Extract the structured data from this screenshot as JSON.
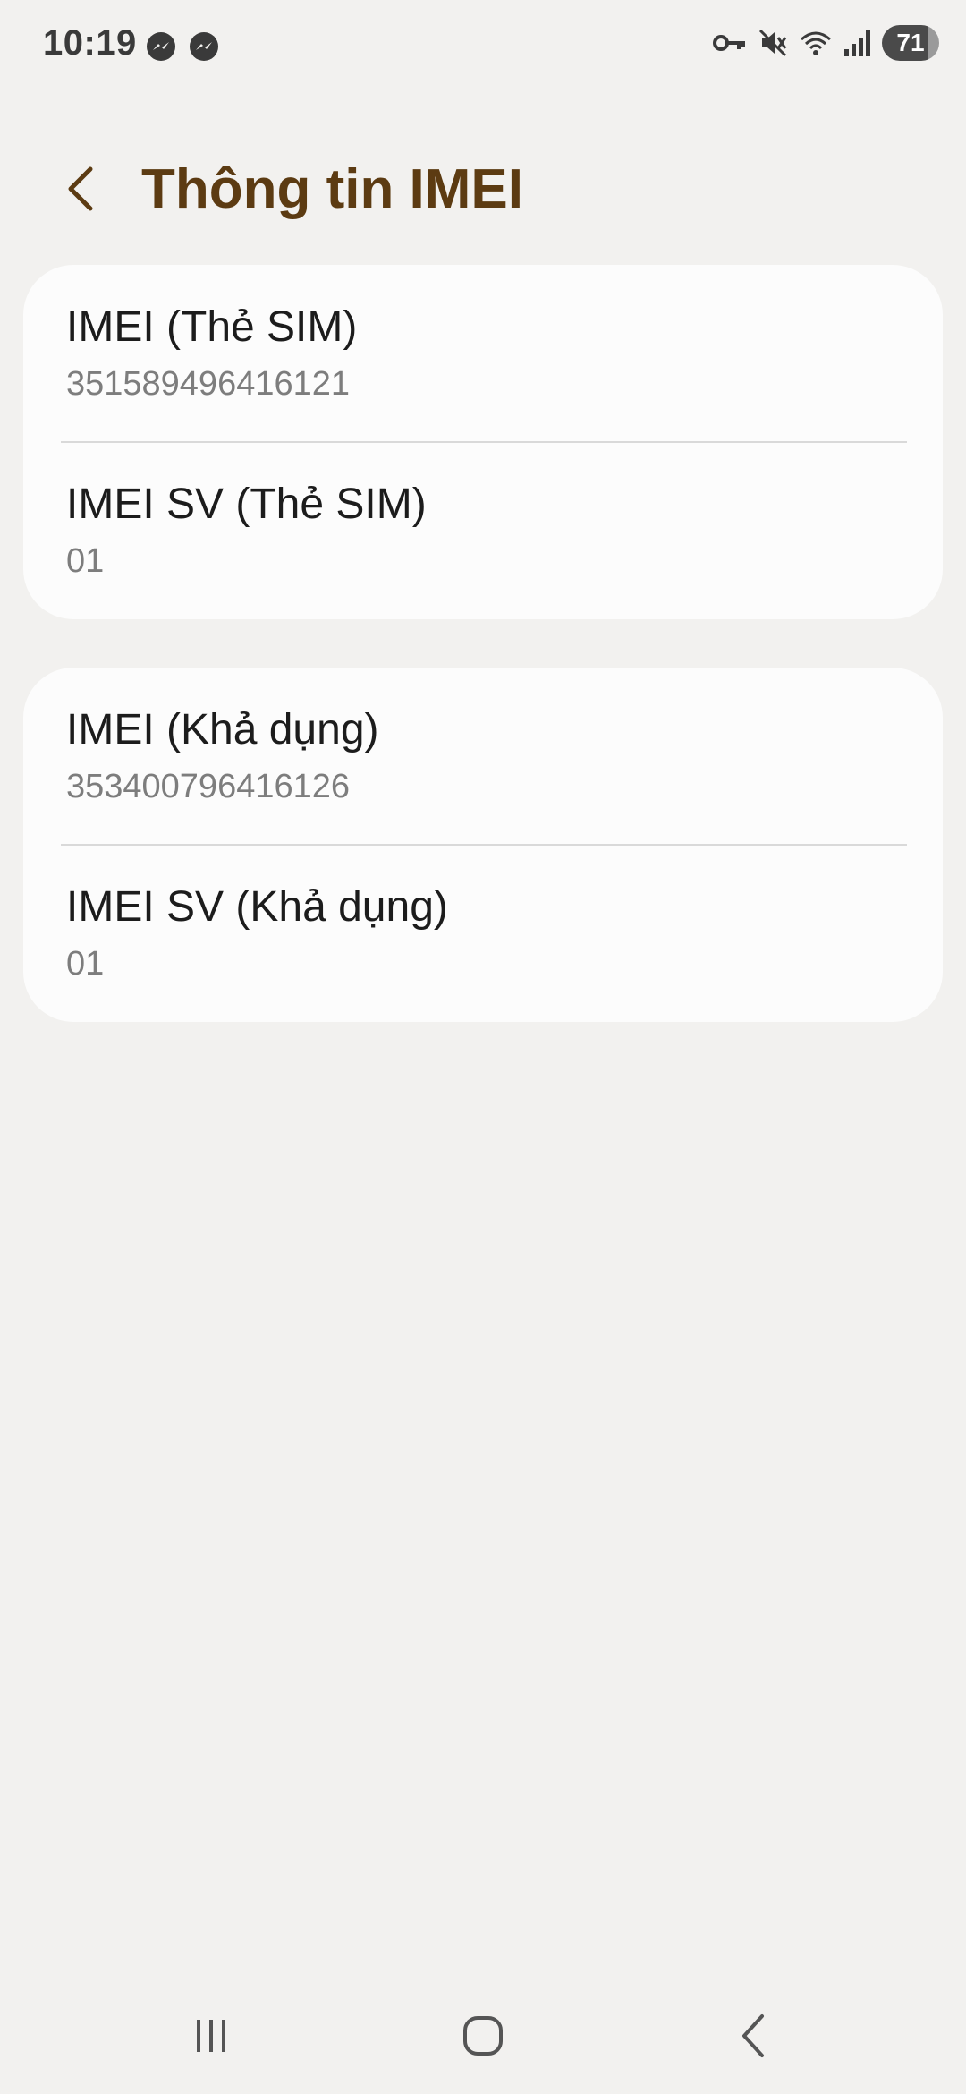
{
  "status_bar": {
    "time": "10:19",
    "left_icons": [
      "messenger-icon",
      "messenger-icon"
    ],
    "right_icons": [
      "vpn-key-icon",
      "mute-icon",
      "wifi-icon",
      "signal-icon"
    ],
    "battery_level": "71"
  },
  "header": {
    "title": "Thông tin IMEI",
    "back_icon": "chevron-left-icon"
  },
  "sections": [
    {
      "items": [
        {
          "label": "IMEI (Thẻ SIM)",
          "value": "351589496416121"
        },
        {
          "label": "IMEI SV (Thẻ SIM)",
          "value": "01"
        }
      ]
    },
    {
      "items": [
        {
          "label": "IMEI (Khả dụng)",
          "value": "353400796416126"
        },
        {
          "label": "IMEI SV (Khả dụng)",
          "value": "01"
        }
      ]
    }
  ],
  "nav_bar": {
    "icons": [
      "recents-icon",
      "home-icon",
      "back-icon"
    ]
  },
  "colors": {
    "background": "#f2f1ef",
    "card": "#fcfcfc",
    "title": "#5c3b12",
    "label": "#1c1c1c",
    "value": "#7d7d7d"
  }
}
